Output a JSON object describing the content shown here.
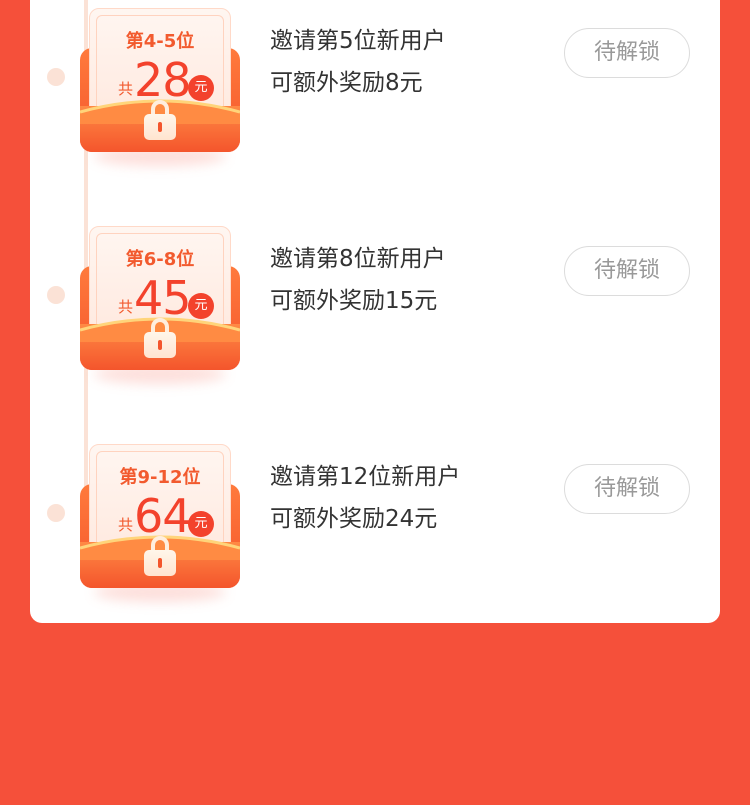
{
  "rewards": [
    {
      "range_label": "第4-5位",
      "total_prefix": "共",
      "total_amount": "28",
      "unit": "元",
      "line1": "邀请第5位新用户",
      "line2": "可额外奖励8元",
      "button_label": "待解锁"
    },
    {
      "range_label": "第6-8位",
      "total_prefix": "共",
      "total_amount": "45",
      "unit": "元",
      "line1": "邀请第8位新用户",
      "line2": "可额外奖励15元",
      "button_label": "待解锁"
    },
    {
      "range_label": "第9-12位",
      "total_prefix": "共",
      "total_amount": "64",
      "unit": "元",
      "line1": "邀请第12位新用户",
      "line2": "可额外奖励24元",
      "button_label": "待解锁"
    }
  ],
  "colors": {
    "page_bg": "#f5503a",
    "accent": "#f3422c",
    "timeline": "#fbe2d6",
    "button_text": "#999999"
  },
  "icons": [
    "lock-icon",
    "red-envelope-icon"
  ]
}
